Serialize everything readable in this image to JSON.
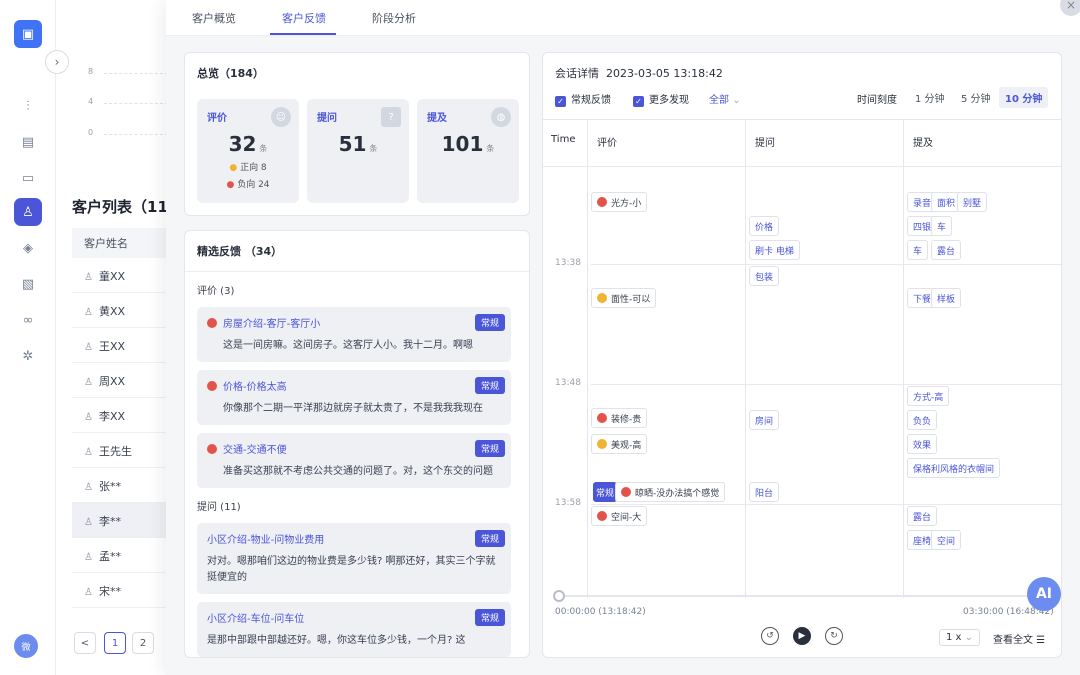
{
  "nav": {
    "icons": [
      "dashboard-icon",
      "chart-icon",
      "doc-icon",
      "box-icon",
      "user-icon",
      "layers-icon",
      "report-icon",
      "link-icon",
      "gear-icon"
    ]
  },
  "bg": {
    "ticks": [
      "8",
      "4",
      "0"
    ],
    "title": "客户列表（11",
    "header": "客户姓名",
    "rows": [
      "童XX",
      "黄XX",
      "王XX",
      "周XX",
      "李XX",
      "王先生",
      "张**",
      "李**",
      "孟**",
      "宋**"
    ],
    "pages": [
      "<",
      "1",
      "2"
    ],
    "avatar": "微"
  },
  "tabs": [
    "客户概览",
    "客户反馈",
    "阶段分析"
  ],
  "overview": {
    "title": "总览（184）",
    "cards": [
      {
        "label": "评价",
        "count": "32",
        "unit": "条",
        "pos": "正向 8",
        "neg": "负向 24"
      },
      {
        "label": "提问",
        "count": "51",
        "unit": "条"
      },
      {
        "label": "提及",
        "count": "101",
        "unit": "条"
      }
    ]
  },
  "selected": {
    "title": "精选反馈 （34）",
    "sections": [
      {
        "name": "评价 (3)",
        "items": [
          {
            "title": "房屋介绍-客厅-客厅小",
            "tag": "常规",
            "text": "这是一间房嘛。这间房子。这客厅人小。我十二月。啊嗯"
          },
          {
            "title": "价格-价格太高",
            "tag": "常规",
            "text": "你像那个二期一平洋那边就房子就太贵了，不是我我我现在"
          },
          {
            "title": "交通-交通不便",
            "tag": "常规",
            "text": "准备买这那就不考虑公共交通的问题了。对，这个东交的问题"
          }
        ]
      },
      {
        "name": "提问 (11)",
        "items": [
          {
            "title": "小区介绍-物业-问物业费用",
            "tag": "常规",
            "text": "对对。嗯那咱们这边的物业费是多少钱? 啊那还好，其实三个字就挺便宜的"
          },
          {
            "title": "小区介绍-车位-问车位",
            "tag": "常规",
            "text": "是那中部跟中部越还好。嗯，你这车位多少钱，一个月? 这"
          }
        ]
      }
    ]
  },
  "session": {
    "title": "会话详情",
    "datetime": "2023-03-05 13:18:42",
    "filters": [
      "常规反馈",
      "更多发现"
    ],
    "all": "全部",
    "scale_label": "时间刻度",
    "scales": [
      "1 分钟",
      "5 分钟",
      "10 分钟"
    ],
    "cols": [
      "Time",
      "评价",
      "提问",
      "提及"
    ],
    "times": [
      "13:38",
      "13:48",
      "13:58"
    ],
    "eval": [
      "光方-小",
      "面性-可以",
      "装修-贵",
      "美观-高",
      "晾晒-没办法搞个感觉",
      "空间-大"
    ],
    "ask": [
      "价格",
      "刷卡 电梯",
      "包装",
      "房间",
      "阳台"
    ],
    "mention": [
      "录音",
      "面积",
      "别墅",
      "四银",
      "车",
      "车",
      "露台",
      "下餐",
      "样板",
      "方式-高",
      "负负",
      "效果",
      "保格利风格的衣帽间",
      "露台",
      "座椅",
      "空间"
    ],
    "short": "常规",
    "start": "00:00:00 (13:18:42)",
    "end": "03:30:00 (16:48:42)",
    "speed": "1 x",
    "full": "查看全文",
    "ai": "AI"
  },
  "colors": {
    "accent": "#4a55d8",
    "neg": "#e2544b",
    "pos": "#f2b233"
  }
}
